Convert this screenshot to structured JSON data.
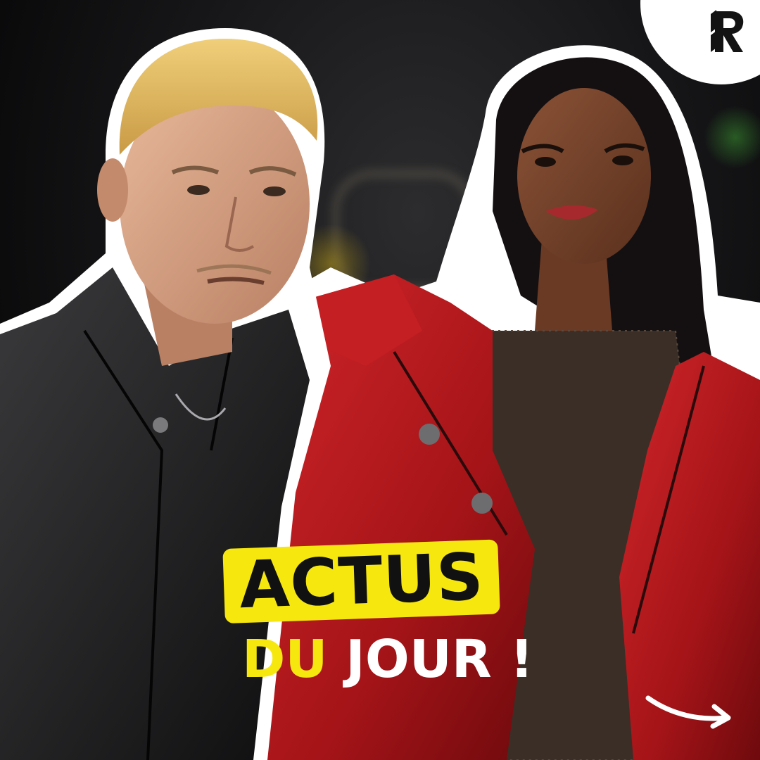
{
  "post": {
    "headline": {
      "main": "ACTUS",
      "sub_accent": "DU",
      "sub_main": "JOUR !"
    },
    "colors": {
      "accent_yellow": "#f6e70f",
      "jacket_red": "#b1151b",
      "background": "#0b0b0d",
      "outline": "#ffffff"
    },
    "icons": {
      "logo": "r-wing-logo-icon",
      "swipe": "swipe-arrow-icon"
    }
  }
}
